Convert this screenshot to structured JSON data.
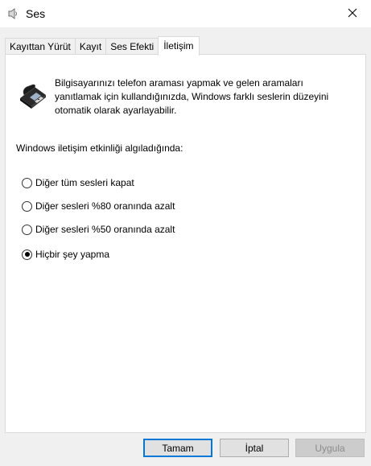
{
  "window": {
    "title": "Ses",
    "close_icon": "close-icon"
  },
  "tabs": [
    {
      "label": "Kayıttan Yürüt",
      "active": false
    },
    {
      "label": "Kayıt",
      "active": false
    },
    {
      "label": "Ses Efekti",
      "active": false
    },
    {
      "label": "İletişim",
      "active": true
    }
  ],
  "communications": {
    "icon": "telephone-icon",
    "description_lines": [
      "Bilgisayarınızı telefon araması yapmak ve gelen aramaları",
      "yanıtlamak için kullandığınızda, Windows farklı seslerin düzeyini",
      "otomatik olarak ayarlayabilir."
    ],
    "prompt": "Windows iletişim etkinliği algıladığında:",
    "options": [
      {
        "label": "Diğer tüm sesleri kapat",
        "selected": false
      },
      {
        "label": "Diğer sesleri %80 oranında azalt",
        "selected": false
      },
      {
        "label": "Diğer sesleri %50 oranında azalt",
        "selected": false
      },
      {
        "label": "Hiçbir şey yapma",
        "selected": true
      }
    ]
  },
  "buttons": {
    "ok": "Tamam",
    "cancel": "İptal",
    "apply": "Uygula"
  },
  "colors": {
    "accent": "#0078d7",
    "panel_bg": "#ffffff",
    "window_bg": "#f0f0f0"
  }
}
